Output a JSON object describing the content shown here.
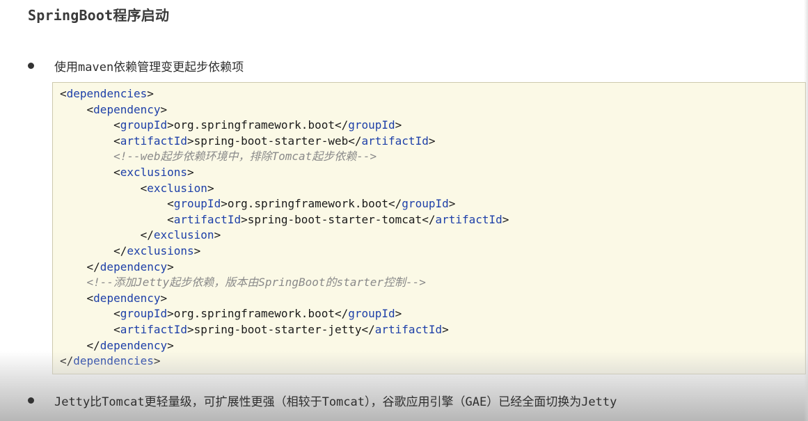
{
  "title": "SpringBoot程序启动",
  "bullets": [
    "使用maven依赖管理变更起步依赖项",
    "Jetty比Tomcat更轻量级，可扩展性更强（相较于Tomcat），谷歌应用引擎（GAE）已经全面切换为Jetty"
  ],
  "code": {
    "lines": [
      {
        "indent": 0,
        "kind": "open",
        "tag": "dependencies"
      },
      {
        "indent": 1,
        "kind": "open",
        "tag": "dependency"
      },
      {
        "indent": 2,
        "kind": "elem",
        "tag": "groupId",
        "text": "org.springframework.boot"
      },
      {
        "indent": 2,
        "kind": "elem",
        "tag": "artifactId",
        "text": "spring-boot-starter-web"
      },
      {
        "indent": 2,
        "kind": "comment",
        "text": "<!--web起步依赖环境中，排除Tomcat起步依赖-->"
      },
      {
        "indent": 2,
        "kind": "open",
        "tag": "exclusions"
      },
      {
        "indent": 3,
        "kind": "open",
        "tag": "exclusion"
      },
      {
        "indent": 4,
        "kind": "elem",
        "tag": "groupId",
        "text": "org.springframework.boot"
      },
      {
        "indent": 4,
        "kind": "elem",
        "tag": "artifactId",
        "text": "spring-boot-starter-tomcat"
      },
      {
        "indent": 3,
        "kind": "close",
        "tag": "exclusion"
      },
      {
        "indent": 2,
        "kind": "close",
        "tag": "exclusions"
      },
      {
        "indent": 1,
        "kind": "close",
        "tag": "dependency"
      },
      {
        "indent": 1,
        "kind": "comment",
        "text": "<!--添加Jetty起步依赖，版本由SpringBoot的starter控制-->"
      },
      {
        "indent": 1,
        "kind": "open",
        "tag": "dependency"
      },
      {
        "indent": 2,
        "kind": "elem",
        "tag": "groupId",
        "text": "org.springframework.boot"
      },
      {
        "indent": 2,
        "kind": "elem",
        "tag": "artifactId",
        "text": "spring-boot-starter-jetty"
      },
      {
        "indent": 1,
        "kind": "close",
        "tag": "dependency"
      },
      {
        "indent": 0,
        "kind": "close",
        "tag": "dependencies"
      }
    ]
  },
  "colors": {
    "code_background": "#fbf9e6",
    "code_border": "#cdc9ad",
    "xml_tag": "#1d3fa8",
    "comment": "#8a8a8a"
  }
}
